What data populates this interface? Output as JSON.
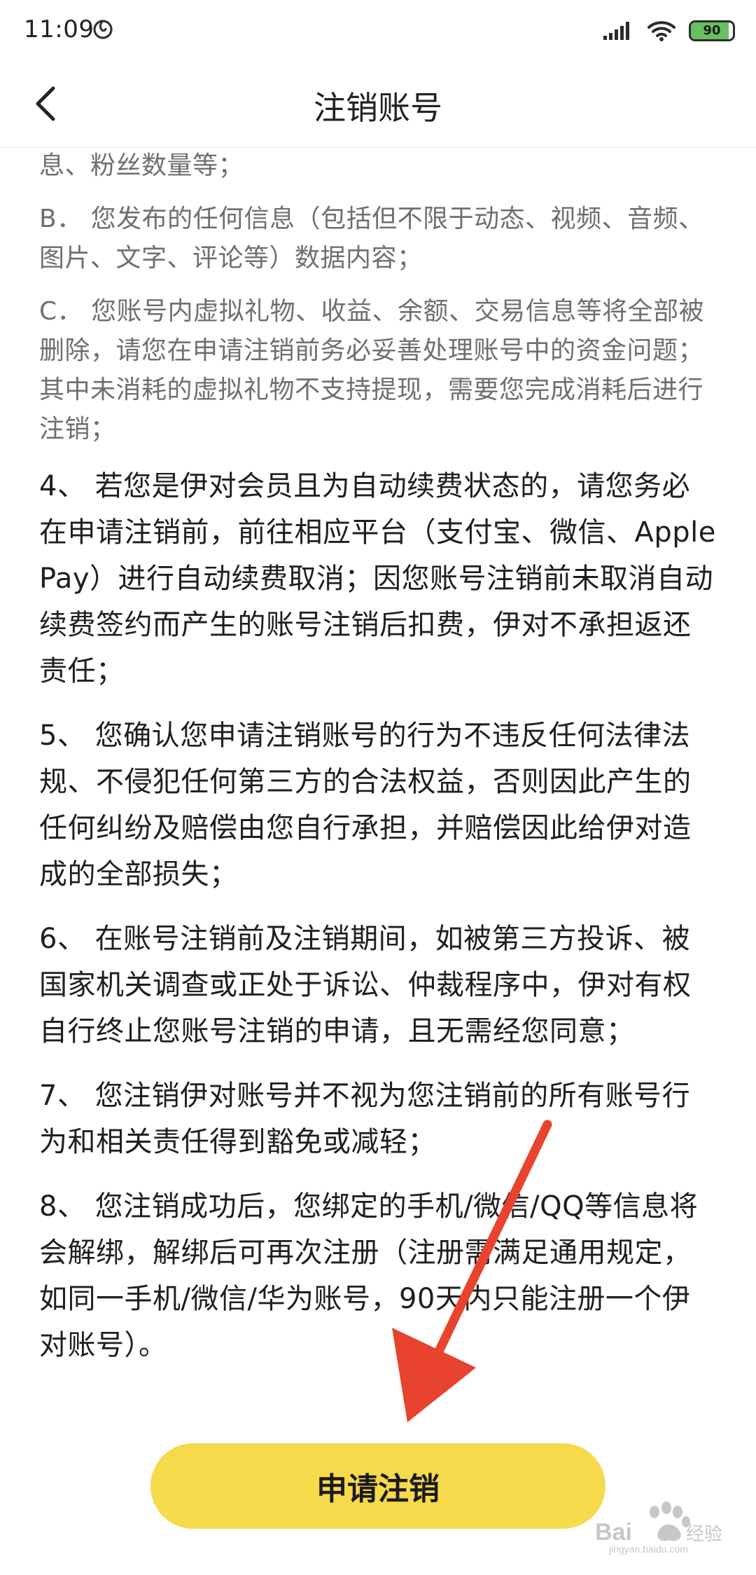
{
  "status_bar": {
    "time": "11:09",
    "app_icon": "netease-music-icon",
    "signal_icon": "signal-bars-icon",
    "wifi_icon": "wifi-icon",
    "battery_level": "90",
    "battery_fraction": 0.9,
    "battery_color": "#67c05f"
  },
  "nav": {
    "title": "注销账号",
    "back_icon": "chevron-left-icon"
  },
  "content": {
    "paragraphs": [
      {
        "text": "息、粉丝数量等；",
        "style": "sub"
      },
      {
        "text": "B． 您发布的任何信息（包括但不限于动态、视频、音频、图片、文字、评论等）数据内容；",
        "style": "sub"
      },
      {
        "text": "C． 您账号内虚拟礼物、收益、余额、交易信息等将全部被删除，请您在申请注销前务必妥善处理账号中的资金问题；其中未消耗的虚拟礼物不支持提现，需要您完成消耗后进行注销；",
        "style": "sub"
      },
      {
        "text": "4、 若您是伊对会员且为自动续费状态的，请您务必在申请注销前，前往相应平台（支付宝、微信、Apple Pay）进行自动续费取消；因您账号注销前未取消自动续费签约而产生的账号注销后扣费，伊对不承担返还责任；",
        "style": "main"
      },
      {
        "text": "5、 您确认您申请注销账号的行为不违反任何法律法规、不侵犯任何第三方的合法权益，否则因此产生的任何纠纷及赔偿由您自行承担，并赔偿因此给伊对造成的全部损失；",
        "style": "main"
      },
      {
        "text": "6、 在账号注销前及注销期间，如被第三方投诉、被国家机关调查或正处于诉讼、仲裁程序中，伊对有权自行终止您账号注销的申请，且无需经您同意；",
        "style": "main"
      },
      {
        "text": "7、 您注销伊对账号并不视为您注销前的所有账号行为和相关责任得到豁免或减轻；",
        "style": "main"
      },
      {
        "text": "8、 您注销成功后，您绑定的手机/微信/QQ等信息将会解绑，解绑后可再次注册（注册需满足通用规定，如同一手机/微信/华为账号，90天内只能注册一个伊对账号）。",
        "style": "main"
      }
    ]
  },
  "action": {
    "apply_label": "申请注销",
    "button_color": "#f7d94c"
  },
  "annotation": {
    "arrow_color": "#e8432e",
    "arrow_icon": "red-arrow-icon"
  },
  "watermark": {
    "icon": "baidu-paw-icon",
    "brand_text": "Bai",
    "brand_text_2": "经验",
    "url": "jingyan.baidu.com"
  }
}
